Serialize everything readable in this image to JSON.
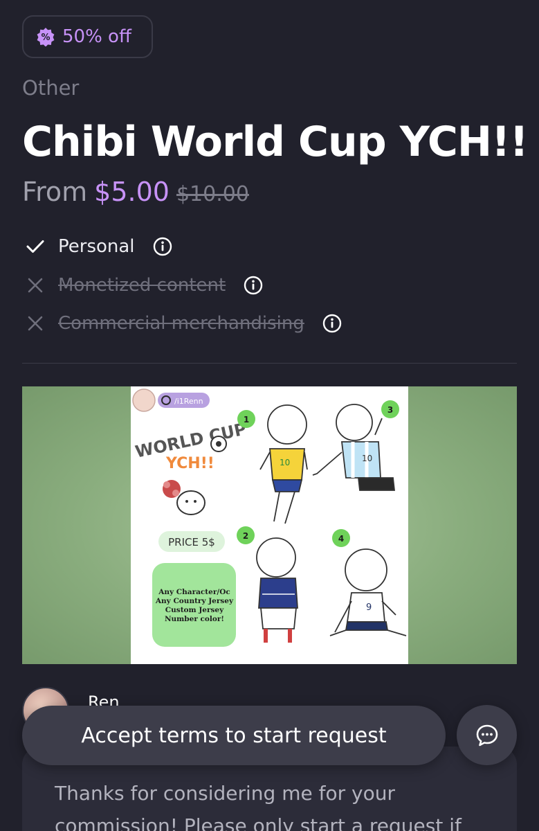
{
  "discount_badge": {
    "icon": "percent-badge-icon",
    "label": "50% off",
    "color": "#c792f7"
  },
  "listing": {
    "category": "Other",
    "title": "Chibi World Cup YCH!!",
    "price_prefix": "From",
    "price_current": "$5.00",
    "price_original": "$10.00"
  },
  "licenses": [
    {
      "label": "Personal",
      "allowed": true,
      "status_icon": "check-icon",
      "info_icon": "info-icon"
    },
    {
      "label": "Monetized content",
      "allowed": false,
      "status_icon": "x-icon",
      "info_icon": "info-icon"
    },
    {
      "label": "Commercial merchandising",
      "allowed": false,
      "status_icon": "x-icon",
      "info_icon": "info-icon"
    }
  ],
  "preview": {
    "handle": "/i1Renn",
    "headline_1": "WORLD CUP",
    "headline_2": "YCH!!",
    "price_tag": "PRICE 5$",
    "notes": [
      "Any Character/Oc",
      "Any Country Jersey",
      "Custom Jersey",
      "Number color!"
    ],
    "pose_numbers": [
      "1",
      "3",
      "2",
      "4"
    ],
    "jersey_numbers": [
      "10",
      "10",
      "9"
    ]
  },
  "artist": {
    "name": "Ren"
  },
  "terms": {
    "text": "Thanks for considering me for your commission! Please only start a request if"
  },
  "actions": {
    "accept_label": "Accept terms to start request",
    "chat_icon": "chat-icon"
  },
  "colors": {
    "background": "#21212c",
    "accent": "#c792f7",
    "button": "#3d3d4a"
  }
}
